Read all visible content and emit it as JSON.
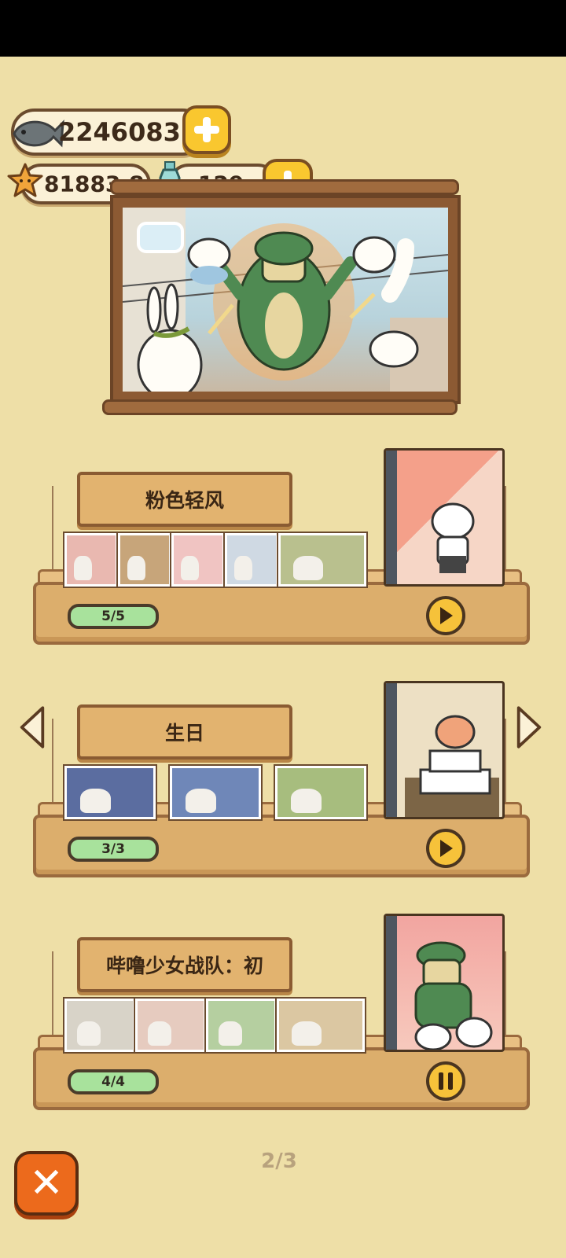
{
  "currencies": {
    "fish": {
      "value": "2246083",
      "icon": "fish-icon"
    },
    "star": {
      "value": "81883.8",
      "icon": "star-icon"
    },
    "bottle": {
      "value": "129",
      "icon": "bottle-icon"
    }
  },
  "albums": [
    {
      "title": "粉色轻风",
      "progress": "5/5",
      "thumb_count": 5,
      "state": "play",
      "cover_colors": [
        "#f4a08a",
        "#f6d6c6"
      ]
    },
    {
      "title": "生日",
      "progress": "3/3",
      "thumb_count": 3,
      "state": "play",
      "cover_colors": [
        "#e9ddc0",
        "#f3e7cf"
      ]
    },
    {
      "title": "哔噜少女战队：初",
      "progress": "4/4",
      "thumb_count": 4,
      "state": "pause",
      "cover_colors": [
        "#f2a5a0",
        "#f7c9bd"
      ]
    }
  ],
  "pagination": {
    "current": "2/3"
  },
  "close_label": "✕",
  "colors": {
    "background": "#eedfa7",
    "accent": "#f6c23a",
    "progress": "#a8e29c",
    "close": "#ec6a1c"
  }
}
